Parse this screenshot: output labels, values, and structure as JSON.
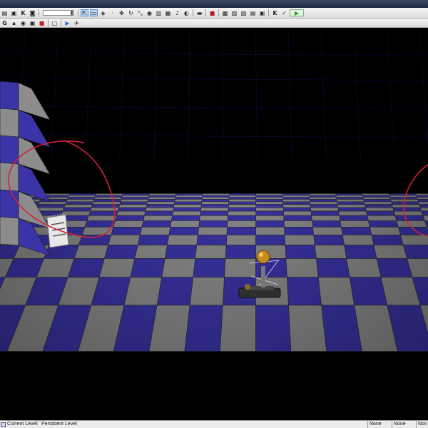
{
  "toolbar_top": {
    "buttons": [
      "file-icon",
      "open-icon",
      "kismet-icon",
      "scene-icon",
      "grid-icon",
      "translate-icon",
      "rotate-icon",
      "scale-icon",
      "camera-icon",
      "brush-icon",
      "actor-icon",
      "sound-icon",
      "material-icon",
      "terrain-icon",
      "light-icon",
      "lightmap-icon",
      "build-icon",
      "paths-icon",
      "cover-icon",
      "all-icon",
      "check-icon",
      "play-icon"
    ]
  },
  "toolbar_second": {
    "g_label": "G",
    "buttons": [
      "lock-icon",
      "eye-icon",
      "camera-icon",
      "stop-icon",
      "realtime-icon",
      "game-view-icon"
    ]
  },
  "viewport": {
    "floor_colors": {
      "blue": "#3a34a6",
      "gray": "#8c8c8c"
    },
    "grid_color": "#1a1aa8",
    "annotation_color": "#d4203a"
  },
  "statusbar": {
    "current_level_label": "Current Level:",
    "current_level_value": "Persistent Level",
    "cells": [
      "None",
      "None",
      "Non"
    ]
  }
}
